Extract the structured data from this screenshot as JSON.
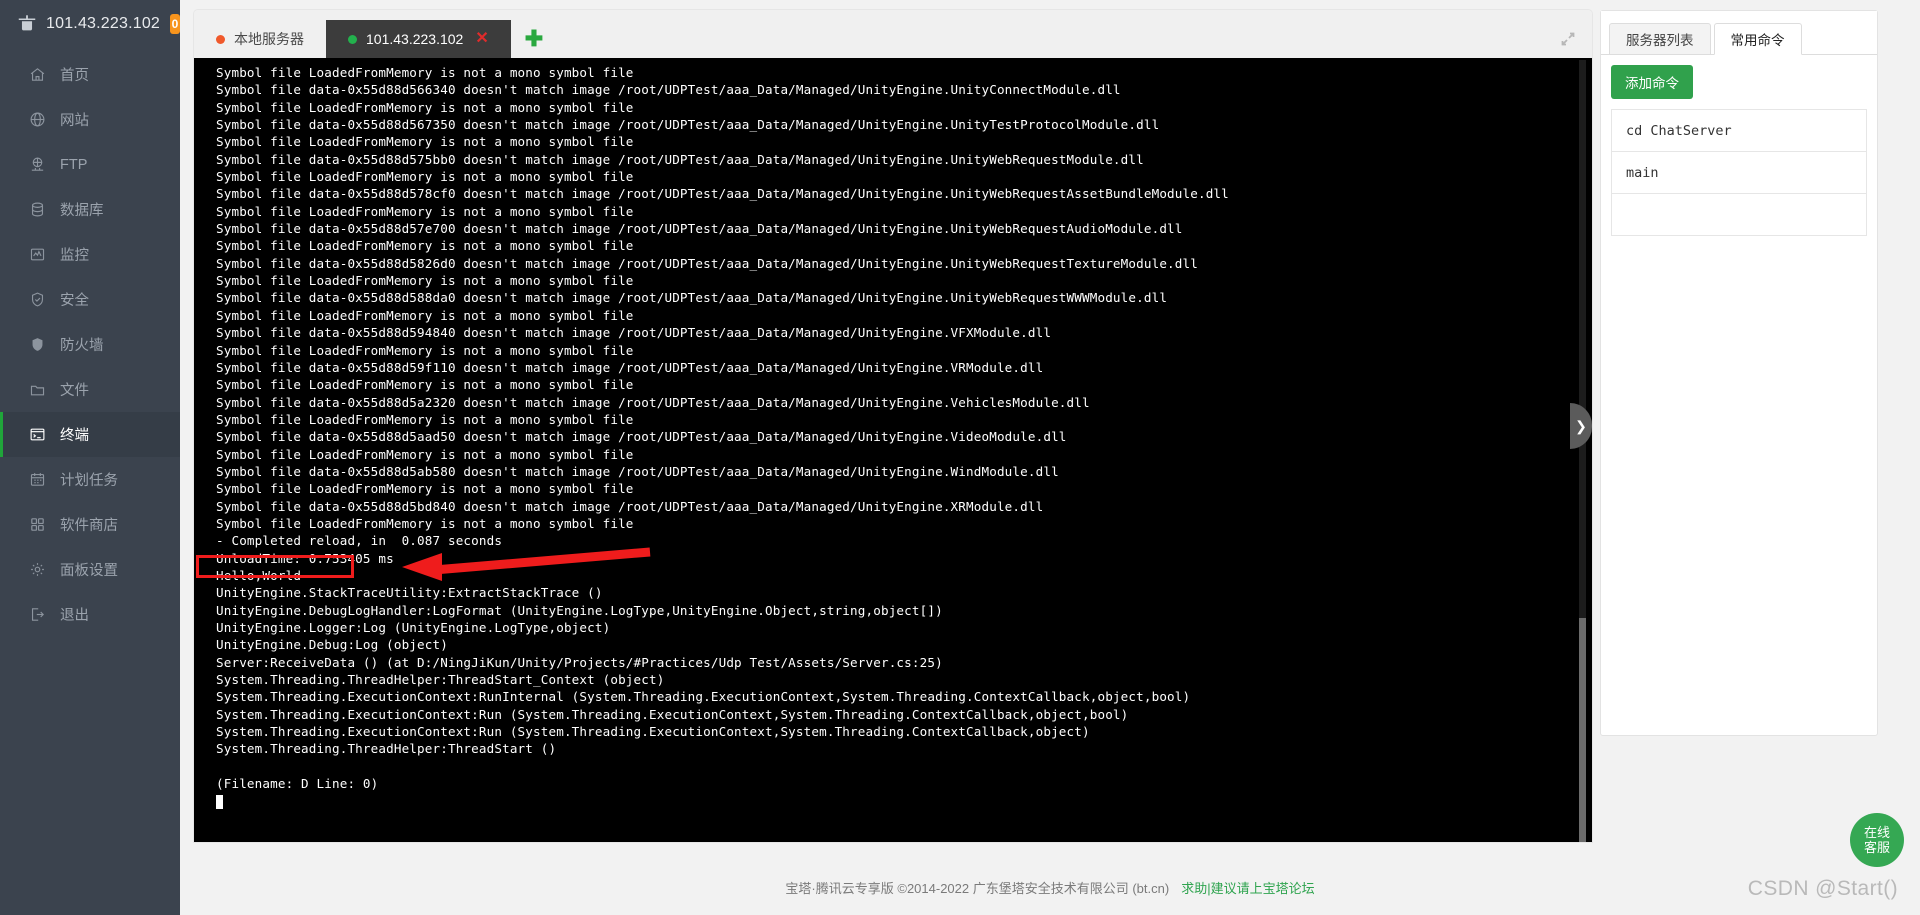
{
  "sidebar": {
    "brand": {
      "ip": "101.43.223.102",
      "badge": "0",
      "logo_icon": "pagoda-logo-icon"
    },
    "items": [
      {
        "label": "首页",
        "icon": "home-icon",
        "active": false
      },
      {
        "label": "网站",
        "icon": "globe-icon",
        "active": false
      },
      {
        "label": "FTP",
        "icon": "ftp-icon",
        "active": false
      },
      {
        "label": "数据库",
        "icon": "database-icon",
        "active": false
      },
      {
        "label": "监控",
        "icon": "monitor-icon",
        "active": false
      },
      {
        "label": "安全",
        "icon": "shield-check-icon",
        "active": false
      },
      {
        "label": "防火墙",
        "icon": "firewall-shield-icon",
        "active": false
      },
      {
        "label": "文件",
        "icon": "folder-icon",
        "active": false
      },
      {
        "label": "终端",
        "icon": "terminal-icon",
        "active": true
      },
      {
        "label": "计划任务",
        "icon": "calendar-icon",
        "active": false
      },
      {
        "label": "软件商店",
        "icon": "grid-apps-icon",
        "active": false
      },
      {
        "label": "面板设置",
        "icon": "gear-icon",
        "active": false
      },
      {
        "label": "退出",
        "icon": "logout-icon",
        "active": false
      }
    ]
  },
  "terminal": {
    "tabs": [
      {
        "label": "本地服务器",
        "dot": "orange",
        "active": false,
        "closable": false
      },
      {
        "label": "101.43.223.102",
        "dot": "green",
        "active": true,
        "closable": true,
        "close_label": "✕"
      }
    ],
    "add_tab_label": "✚",
    "expand_icon": "fullscreen-expand-icon",
    "slide_handle_icon": "chevron-right-icon",
    "slide_handle_label": "❯",
    "annotation": {
      "highlight_text": "Hello,World",
      "arrow_color": "#ef1c1c",
      "box_color": "#ef1c1c"
    },
    "output": "Symbol file LoadedFromMemory is not a mono symbol file\nSymbol file data-0x55d88d566340 doesn't match image /root/UDPTest/aaa_Data/Managed/UnityEngine.UnityConnectModule.dll\nSymbol file LoadedFromMemory is not a mono symbol file\nSymbol file data-0x55d88d567350 doesn't match image /root/UDPTest/aaa_Data/Managed/UnityEngine.UnityTestProtocolModule.dll\nSymbol file LoadedFromMemory is not a mono symbol file\nSymbol file data-0x55d88d575bb0 doesn't match image /root/UDPTest/aaa_Data/Managed/UnityEngine.UnityWebRequestModule.dll\nSymbol file LoadedFromMemory is not a mono symbol file\nSymbol file data-0x55d88d578cf0 doesn't match image /root/UDPTest/aaa_Data/Managed/UnityEngine.UnityWebRequestAssetBundleModule.dll\nSymbol file LoadedFromMemory is not a mono symbol file\nSymbol file data-0x55d88d57e700 doesn't match image /root/UDPTest/aaa_Data/Managed/UnityEngine.UnityWebRequestAudioModule.dll\nSymbol file LoadedFromMemory is not a mono symbol file\nSymbol file data-0x55d88d5826d0 doesn't match image /root/UDPTest/aaa_Data/Managed/UnityEngine.UnityWebRequestTextureModule.dll\nSymbol file LoadedFromMemory is not a mono symbol file\nSymbol file data-0x55d88d588da0 doesn't match image /root/UDPTest/aaa_Data/Managed/UnityEngine.UnityWebRequestWWWModule.dll\nSymbol file LoadedFromMemory is not a mono symbol file\nSymbol file data-0x55d88d594840 doesn't match image /root/UDPTest/aaa_Data/Managed/UnityEngine.VFXModule.dll\nSymbol file LoadedFromMemory is not a mono symbol file\nSymbol file data-0x55d88d59f110 doesn't match image /root/UDPTest/aaa_Data/Managed/UnityEngine.VRModule.dll\nSymbol file LoadedFromMemory is not a mono symbol file\nSymbol file data-0x55d88d5a2320 doesn't match image /root/UDPTest/aaa_Data/Managed/UnityEngine.VehiclesModule.dll\nSymbol file LoadedFromMemory is not a mono symbol file\nSymbol file data-0x55d88d5aad50 doesn't match image /root/UDPTest/aaa_Data/Managed/UnityEngine.VideoModule.dll\nSymbol file LoadedFromMemory is not a mono symbol file\nSymbol file data-0x55d88d5ab580 doesn't match image /root/UDPTest/aaa_Data/Managed/UnityEngine.WindModule.dll\nSymbol file LoadedFromMemory is not a mono symbol file\nSymbol file data-0x55d88d5bd840 doesn't match image /root/UDPTest/aaa_Data/Managed/UnityEngine.XRModule.dll\nSymbol file LoadedFromMemory is not a mono symbol file\n- Completed reload, in  0.087 seconds\nUnloadTime: 0.753405 ms\nHello,World\nUnityEngine.StackTraceUtility:ExtractStackTrace ()\nUnityEngine.DebugLogHandler:LogFormat (UnityEngine.LogType,UnityEngine.Object,string,object[])\nUnityEngine.Logger:Log (UnityEngine.LogType,object)\nUnityEngine.Debug:Log (object)\nServer:ReceiveData () (at D:/NingJiKun/Unity/Projects/#Practices/Udp Test/Assets/Server.cs:25)\nSystem.Threading.ThreadHelper:ThreadStart_Context (object)\nSystem.Threading.ExecutionContext:RunInternal (System.Threading.ExecutionContext,System.Threading.ContextCallback,object,bool)\nSystem.Threading.ExecutionContext:Run (System.Threading.ExecutionContext,System.Threading.ContextCallback,object,bool)\nSystem.Threading.ExecutionContext:Run (System.Threading.ExecutionContext,System.Threading.ContextCallback,object)\nSystem.Threading.ThreadHelper:ThreadStart ()\n\n(Filename: D Line: 0)\n"
  },
  "right_panel": {
    "tabs": [
      {
        "label": "服务器列表",
        "active": false
      },
      {
        "label": "常用命令",
        "active": true
      }
    ],
    "add_button": "添加命令",
    "commands": [
      {
        "text": "cd ChatServer"
      },
      {
        "text": "main"
      }
    ]
  },
  "footer": {
    "copyright": "宝塔·腾讯云专享版 ©2014-2022 广东堡塔安全技术有限公司 (bt.cn)",
    "link": "求助|建议请上宝塔论坛"
  },
  "fab": {
    "line1": "在线",
    "line2": "客服"
  },
  "watermark": "CSDN @Start()",
  "colors": {
    "sidebar_bg": "#3b434e",
    "sidebar_active_bg": "#353d47",
    "accent_green": "#20a53a",
    "badge_orange": "#f7941d",
    "annotation_red": "#ef1c1c",
    "terminal_bg": "#000000"
  }
}
